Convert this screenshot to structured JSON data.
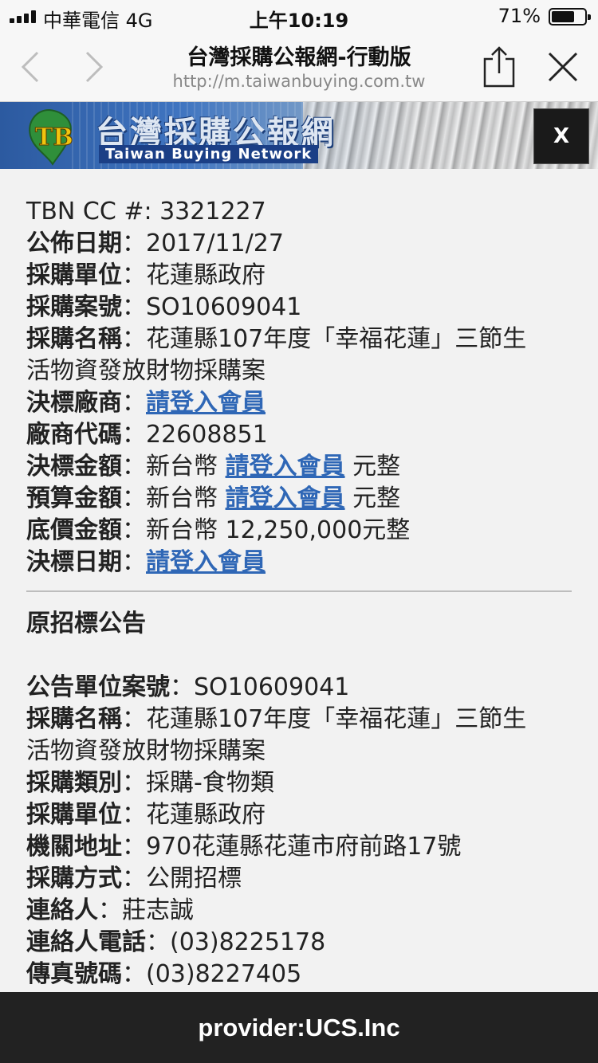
{
  "status_bar": {
    "carrier": "中華電信  4G",
    "time": "上午10:19",
    "battery": "71%",
    "battery_level": 0.71
  },
  "nav": {
    "title": "台灣採購公報網-行動版",
    "url": "http://m.taiwanbuying.com.tw"
  },
  "banner": {
    "logo_text": "TB",
    "title": "台灣採購公報網",
    "subtitle": "Taiwan Buying Network",
    "close_label": "X"
  },
  "award": {
    "tbn": {
      "label": "TBN CC #:",
      "value": " 3321227"
    },
    "publish_date": {
      "label": "公佈日期",
      "value": "：2017/11/27"
    },
    "agency": {
      "label": "採購單位",
      "value": "：花蓮縣政府"
    },
    "case_no": {
      "label": "採購案號",
      "value": "：SO10609041"
    },
    "name": {
      "label": "採購名稱",
      "value": "：花蓮縣107年度「幸福花蓮」三節生",
      "value_cont": "活物資發放財物採購案"
    },
    "vendor": {
      "label": "決標廠商",
      "sep": "：",
      "link": "請登入會員"
    },
    "vendor_code": {
      "label": "廠商代碼",
      "value": "：22608851"
    },
    "award_amount": {
      "label": "決標金額",
      "prefix": "：新台幣 ",
      "link": "請登入會員",
      "suffix": " 元整"
    },
    "budget_amount": {
      "label": "預算金額",
      "prefix": "：新台幣 ",
      "link": "請登入會員",
      "suffix": " 元整"
    },
    "base_price": {
      "label": "底價金額",
      "value": "：新台幣 12,250,000元整"
    },
    "award_date": {
      "label": "決標日期",
      "sep": "：",
      "link": "請登入會員"
    }
  },
  "original": {
    "section_title": "原招標公告",
    "case_no": {
      "label": "公告單位案號",
      "value": "：SO10609041"
    },
    "name": {
      "label": "採購名稱",
      "value": "：花蓮縣107年度「幸福花蓮」三節生",
      "value_cont": "活物資發放財物採購案"
    },
    "category": {
      "label": "採購類別",
      "value": "：採購-食物類"
    },
    "agency": {
      "label": "採購單位",
      "value": "：花蓮縣政府"
    },
    "address": {
      "label": "機關地址",
      "value": "：970花蓮縣花蓮市府前路17號"
    },
    "method": {
      "label": "採購方式",
      "value": "：公開招標"
    },
    "contact": {
      "label": "連絡人",
      "value": "：莊志誠"
    },
    "phone": {
      "label": "連絡人電話",
      "value": "：(03)8225178"
    },
    "fax": {
      "label": "傳真號碼",
      "value": "：(03)8227405"
    }
  },
  "footer": {
    "text": "provider:UCS.Inc"
  }
}
